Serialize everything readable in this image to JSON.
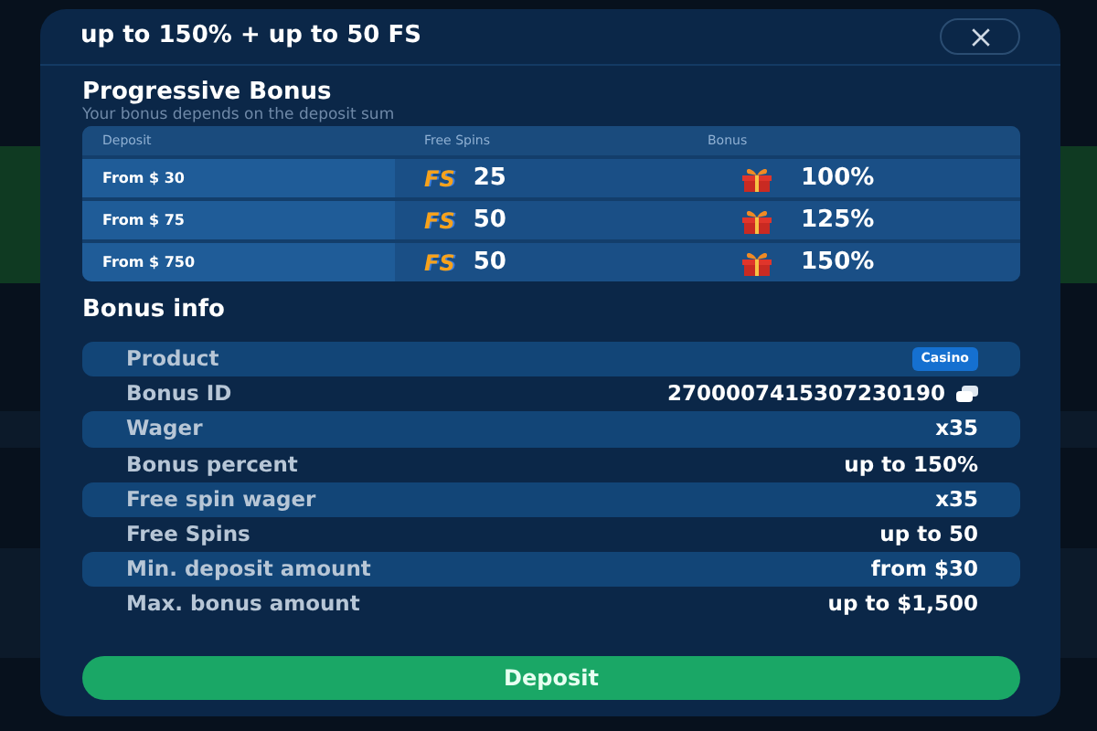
{
  "modal": {
    "title": "up to 150% + up to 50 FS"
  },
  "progressive": {
    "title": "Progressive Bonus",
    "subtitle": "Your bonus depends on the deposit sum",
    "columns": [
      "Deposit",
      "Free Spins",
      "Bonus"
    ],
    "rows": [
      {
        "deposit": "From $ 30",
        "fs_label": "FS",
        "spins": "25",
        "bonus": "100%"
      },
      {
        "deposit": "From $ 75",
        "fs_label": "FS",
        "spins": "50",
        "bonus": "125%"
      },
      {
        "deposit": "From $ 750",
        "fs_label": "FS",
        "spins": "50",
        "bonus": "150%"
      }
    ]
  },
  "info": {
    "title": "Bonus info",
    "rows": [
      {
        "label": "Product",
        "value": "Casino",
        "kind": "tag"
      },
      {
        "label": "Bonus ID",
        "value": "2700007415307230190",
        "kind": "copy"
      },
      {
        "label": "Wager",
        "value": "x35",
        "kind": "text"
      },
      {
        "label": "Bonus percent",
        "value": "up to 150%",
        "kind": "text"
      },
      {
        "label": "Free spin wager",
        "value": "x35",
        "kind": "text"
      },
      {
        "label": "Free Spins",
        "value": "up to 50",
        "kind": "text"
      },
      {
        "label": "Min. deposit amount",
        "value": "from $30",
        "kind": "text"
      },
      {
        "label": "Max. bonus amount",
        "value": "up to $1,500",
        "kind": "text"
      }
    ]
  },
  "button": "Deposit"
}
